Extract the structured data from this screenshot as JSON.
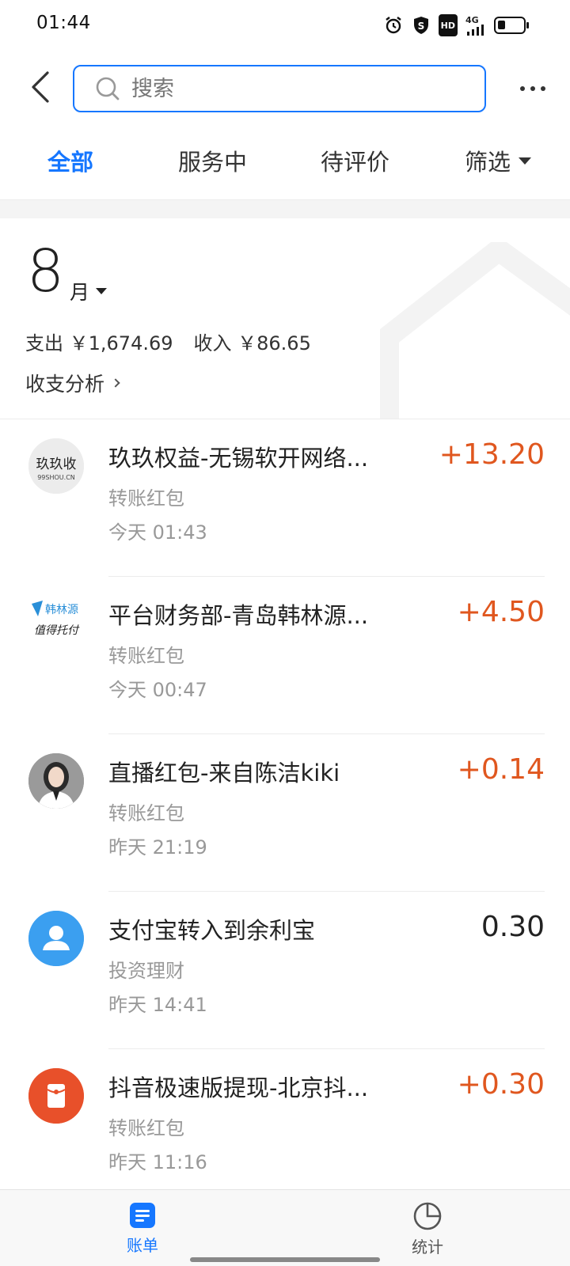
{
  "status_bar": {
    "time": "01:44",
    "network": "4G",
    "hd": "HD",
    "icons": [
      "alarm-icon",
      "shield-icon",
      "hd-icon",
      "signal-icon",
      "battery-icon"
    ]
  },
  "header": {
    "search_placeholder": "搜索",
    "back_icon": "chevron-left-icon",
    "more_icon": "more-dots-icon"
  },
  "tabs": [
    {
      "label": "全部",
      "active": true
    },
    {
      "label": "服务中",
      "active": false
    },
    {
      "label": "待评价",
      "active": false
    },
    {
      "label": "筛选",
      "active": false
    }
  ],
  "summary": {
    "month": "8",
    "month_unit": "月",
    "expense": "支出 ￥1,674.69",
    "income": "收入 ￥86.65",
    "analysis_link": "收支分析"
  },
  "transactions": [
    {
      "title": "玖玖权益-无锡软开网络...",
      "category": "转账红包",
      "time": "今天  01:43",
      "amount": "+13.20",
      "avatar": "99shou-logo"
    },
    {
      "title": "平台财务部-青岛韩林源...",
      "category": "转账红包",
      "time": "今天  00:47",
      "amount": "+4.50",
      "avatar": "hanlinyuan-logo"
    },
    {
      "title": "直播红包-来自陈洁kiki",
      "category": "转账红包",
      "time": "昨天  21:19",
      "amount": "+0.14",
      "avatar": "user-photo"
    },
    {
      "title": "支付宝转入到余利宝",
      "category": "投资理财",
      "time": "昨天  14:41",
      "amount": "0.30",
      "avatar": "person-icon"
    },
    {
      "title": "抖音极速版提现-北京抖...",
      "category": "转账红包",
      "time": "昨天  11:16",
      "amount": "+0.30",
      "avatar": "red-packet-icon"
    }
  ],
  "logos": {
    "logo1_text": "玖玖收",
    "logo1_url": "99SHOU.CN",
    "logo2_line1": "韩林源",
    "logo2_line2": "值得托付"
  },
  "bottom_nav": [
    {
      "label": "账单",
      "icon": "bill-icon",
      "active": true
    },
    {
      "label": "统计",
      "icon": "pie-chart-icon",
      "active": false
    }
  ],
  "colors": {
    "accent": "#1677ff",
    "income": "#e0571f",
    "secondary_text": "#999999",
    "avatar_blue": "#3b9ff0",
    "avatar_red": "#e8502a"
  }
}
